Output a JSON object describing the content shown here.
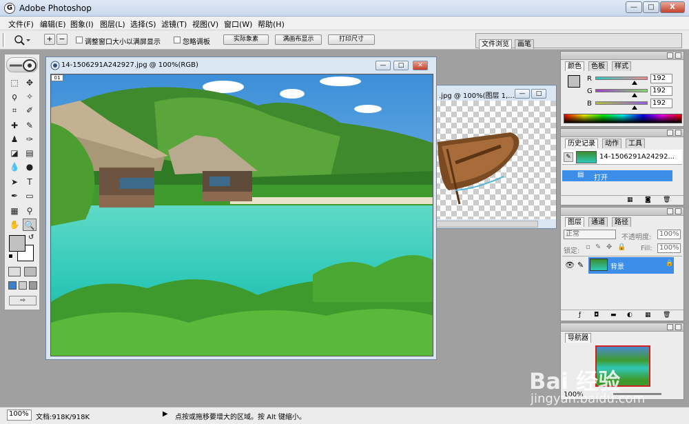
{
  "app": {
    "title": "Adobe Photoshop",
    "icon_letter": "G"
  },
  "window_buttons": {
    "minimize": "—",
    "maximize": "□",
    "close": "X"
  },
  "menu": [
    "文件(F)",
    "编辑(E)",
    "图象(I)",
    "图层(L)",
    "选择(S)",
    "滤镜(T)",
    "视图(V)",
    "窗口(W)",
    "帮助(H)"
  ],
  "options": {
    "zoom_in": "+",
    "zoom_out": "−",
    "resize_window_label": "调整窗口大小以满屏显示",
    "ignore_palettes_label": "忽略调板",
    "actual_pixels": "实际象素",
    "fit_on_screen": "满画布显示",
    "print_size": "打印尺寸",
    "file_browser_tab": "文件浏览",
    "brushes_tab": "画笔"
  },
  "document_main": {
    "title": "14-1506291A242927.jpg @ 100%(RGB)",
    "badge": "01"
  },
  "document_back": {
    "title": ".jpg @ 100%(图层 1,..."
  },
  "color_panel": {
    "tabs": [
      "颜色",
      "色板",
      "样式"
    ],
    "channels": [
      {
        "label": "R",
        "value": "192",
        "fraction": 0.75
      },
      {
        "label": "G",
        "value": "192",
        "fraction": 0.75
      },
      {
        "label": "B",
        "value": "192",
        "fraction": 0.75
      }
    ]
  },
  "history_panel": {
    "tabs": [
      "历史记录",
      "动作",
      "工具"
    ],
    "snapshot": "14-1506291A24292...",
    "step": "打开"
  },
  "layers_panel": {
    "tabs": [
      "图层",
      "通道",
      "路径"
    ],
    "blend_mode": "正常",
    "opacity_label": "不透明度:",
    "opacity_value": "100%",
    "lock_label": "锁定:",
    "fill_label": "Fill:",
    "fill_value": "100%",
    "layer_name": "背景"
  },
  "navigator_panel": {
    "tabs": [
      "导航器"
    ],
    "zoom": "100%"
  },
  "status": {
    "zoom": "100%",
    "doc_size": "文档:918K/918K",
    "hint": "点按或拖移要增大的区域。按 Alt 键缩小。"
  },
  "watermark": {
    "brand": "Bai 经验",
    "url": "jingyan.baidu.com"
  },
  "colors": {
    "accent": "#3d8ee8",
    "sea": "#2fc9b8",
    "foliage": "#3f9a2e",
    "sky": "#5aa8e8"
  }
}
